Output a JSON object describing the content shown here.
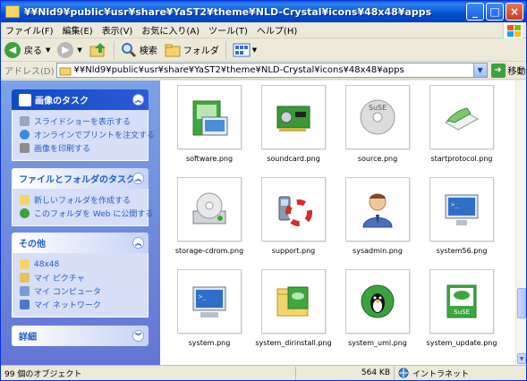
{
  "window": {
    "title": "¥¥Nld9¥public¥usr¥share¥YaST2¥theme¥NLD-Crystal¥icons¥48x48¥apps",
    "minimize": "_",
    "maximize": "□",
    "close": "×"
  },
  "menu": [
    "ファイル(F)",
    "編集(E)",
    "表示(V)",
    "お気に入り(A)",
    "ツール(T)",
    "ヘルプ(H)"
  ],
  "toolbar": {
    "back_label": "戻る",
    "search_label": "検索",
    "folders_label": "フォルダ"
  },
  "address": {
    "label": "アドレス(D)",
    "value": "¥¥Nld9¥public¥usr¥share¥YaST2¥theme¥NLD-Crystal¥icons¥48x48¥apps",
    "go_label": "移動"
  },
  "panels": {
    "picture_tasks": {
      "title": "画像のタスク",
      "items": [
        "スライドショーを表示する",
        "オンラインでプリントを注文する",
        "画像を印刷する"
      ]
    },
    "file_tasks": {
      "title": "ファイルとフォルダのタスク",
      "items": [
        "新しいフォルダを作成する",
        "このフォルダを Web に公開する"
      ]
    },
    "other_places": {
      "title": "その他",
      "items": [
        "48x48",
        "マイ ピクチャ",
        "マイ コンピュータ",
        "マイ ネットワーク"
      ]
    },
    "details": {
      "title": "詳細"
    }
  },
  "files": [
    {
      "name": "software.png",
      "icon": "software-installer-icon"
    },
    {
      "name": "soundcard.png",
      "icon": "soundcard-icon"
    },
    {
      "name": "source.png",
      "icon": "suse-cd-icon"
    },
    {
      "name": "startprotocol.png",
      "icon": "start-protocol-icon"
    },
    {
      "name": "storage-cdrom.png",
      "icon": "cdrom-drive-icon"
    },
    {
      "name": "support.png",
      "icon": "support-lifebuoy-icon"
    },
    {
      "name": "sysadmin.png",
      "icon": "sysadmin-person-icon"
    },
    {
      "name": "system56.png",
      "icon": "monitor-icon"
    },
    {
      "name": "system.png",
      "icon": "system-monitor-icon"
    },
    {
      "name": "system_dirinstall.png",
      "icon": "dir-install-icon"
    },
    {
      "name": "system_uml.png",
      "icon": "tux-icon"
    },
    {
      "name": "system_update.png",
      "icon": "suse-update-icon"
    }
  ],
  "status": {
    "objects": "99 個のオブジェクト",
    "size": "564 KB",
    "zone": "イントラネット"
  },
  "colors": {
    "title_blue": "#0450d0",
    "link_blue": "#215dc6",
    "pane_gradient_top": "#7ba2e7"
  }
}
